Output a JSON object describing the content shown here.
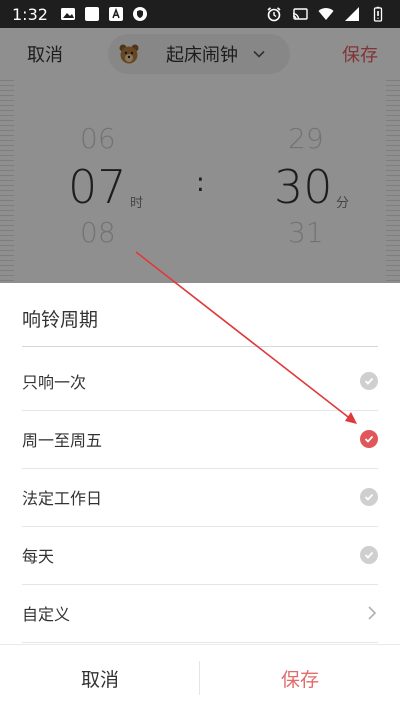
{
  "status_bar": {
    "time": "1:32",
    "left_icons": [
      "image-icon",
      "square-icon",
      "a-letter-icon",
      "shield-icon"
    ],
    "right_icons": [
      "alarm-icon",
      "cast-icon",
      "wifi-icon",
      "signal-icon",
      "battery-icon"
    ]
  },
  "top_bar": {
    "cancel_label": "取消",
    "title": "起床闹钟",
    "save_label": "保存",
    "title_icon": "bear-icon",
    "dropdown_icon": "chevron-down-icon",
    "save_color": "#e05a5a"
  },
  "time_picker": {
    "hour_prev": "06",
    "hour": "07",
    "hour_next": "08",
    "hour_unit": "时",
    "separator": ":",
    "minute_prev": "29",
    "minute": "30",
    "minute_next": "31",
    "minute_unit": "分"
  },
  "sheet": {
    "title": "响铃周期",
    "options": [
      {
        "label": "只响一次",
        "selected": false,
        "icon": "check-circle-icon"
      },
      {
        "label": "周一至周五",
        "selected": true,
        "icon": "check-circle-icon"
      },
      {
        "label": "法定工作日",
        "selected": false,
        "icon": "check-circle-icon"
      },
      {
        "label": "每天",
        "selected": false,
        "icon": "check-circle-icon"
      },
      {
        "label": "自定义",
        "selected": false,
        "icon": "chevron-right-icon"
      }
    ],
    "accent_color": "#e0565a"
  },
  "bottom_bar": {
    "cancel_label": "取消",
    "save_label": "保存",
    "save_color": "#e26b6b"
  },
  "annotation": {
    "color": "#e0393c"
  }
}
